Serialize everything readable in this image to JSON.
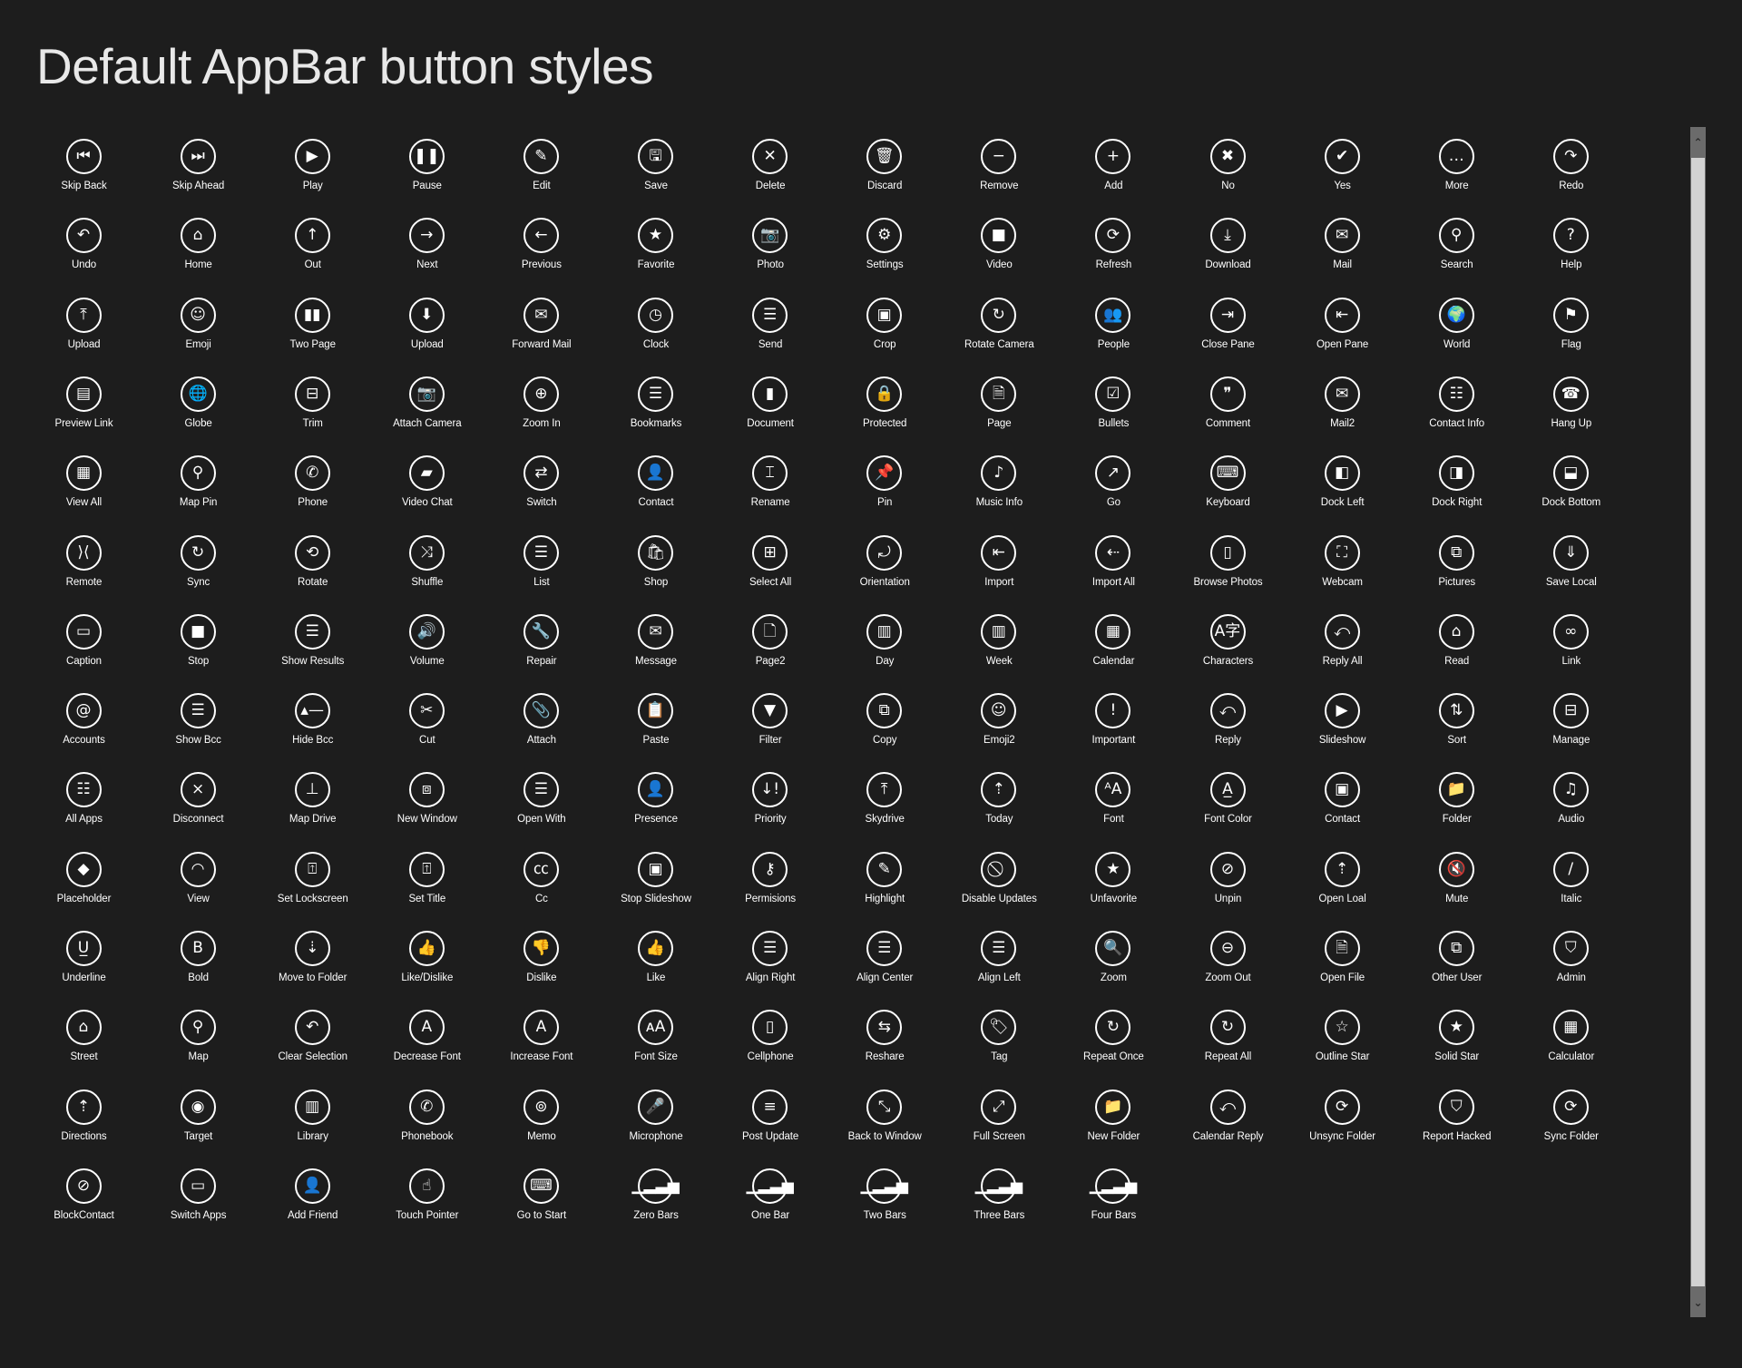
{
  "page": {
    "title": "Default AppBar button styles"
  },
  "colors": {
    "background": "#1d1d1d",
    "foreground": "#ffffff",
    "scrollbar_track": "#6b6b6b",
    "scrollbar_thumb": "#d2d2d2"
  },
  "scrollbar": {
    "up_glyph": "⌃",
    "down_glyph": "⌄"
  },
  "buttons": [
    {
      "label": "Skip Back",
      "icon": "skip-back-icon",
      "glyph": "⏮"
    },
    {
      "label": "Skip Ahead",
      "icon": "skip-ahead-icon",
      "glyph": "⏭"
    },
    {
      "label": "Play",
      "icon": "play-icon",
      "glyph": "▶"
    },
    {
      "label": "Pause",
      "icon": "pause-icon",
      "glyph": "❚❚"
    },
    {
      "label": "Edit",
      "icon": "pencil-icon",
      "glyph": "✎"
    },
    {
      "label": "Save",
      "icon": "floppy-icon",
      "glyph": "🖫"
    },
    {
      "label": "Delete",
      "icon": "delete-x-icon",
      "glyph": "✕"
    },
    {
      "label": "Discard",
      "icon": "trash-icon",
      "glyph": "🗑"
    },
    {
      "label": "Remove",
      "icon": "minus-icon",
      "glyph": "−"
    },
    {
      "label": "Add",
      "icon": "plus-icon",
      "glyph": "+"
    },
    {
      "label": "No",
      "icon": "x-icon",
      "glyph": "✖"
    },
    {
      "label": "Yes",
      "icon": "check-icon",
      "glyph": "✔"
    },
    {
      "label": "More",
      "icon": "ellipsis-icon",
      "glyph": "…"
    },
    {
      "label": "Redo",
      "icon": "redo-icon",
      "glyph": "↷"
    },
    {
      "label": "Undo",
      "icon": "undo-icon",
      "glyph": "↶"
    },
    {
      "label": "Home",
      "icon": "home-icon",
      "glyph": "⌂"
    },
    {
      "label": "Out",
      "icon": "arrow-up-icon",
      "glyph": "↑"
    },
    {
      "label": "Next",
      "icon": "arrow-right-icon",
      "glyph": "→"
    },
    {
      "label": "Previous",
      "icon": "arrow-left-icon",
      "glyph": "←"
    },
    {
      "label": "Favorite",
      "icon": "star-icon",
      "glyph": "★"
    },
    {
      "label": "Photo",
      "icon": "camera-icon",
      "glyph": "📷"
    },
    {
      "label": "Settings",
      "icon": "gear-icon",
      "glyph": "⚙"
    },
    {
      "label": "Video",
      "icon": "video-camera-icon",
      "glyph": "■"
    },
    {
      "label": "Refresh",
      "icon": "refresh-icon",
      "glyph": "⟳"
    },
    {
      "label": "Download",
      "icon": "download-icon",
      "glyph": "⤓"
    },
    {
      "label": "Mail",
      "icon": "mail-icon",
      "glyph": "✉"
    },
    {
      "label": "Search",
      "icon": "search-icon",
      "glyph": "⚲"
    },
    {
      "label": "Help",
      "icon": "question-icon",
      "glyph": "?"
    },
    {
      "label": "Upload",
      "icon": "upload-icon",
      "glyph": "⤒"
    },
    {
      "label": "Emoji",
      "icon": "emoji-icon",
      "glyph": "☺"
    },
    {
      "label": "Two Page",
      "icon": "two-page-icon",
      "glyph": "▮▮"
    },
    {
      "label": "Upload",
      "icon": "upload-bubble-icon",
      "glyph": "⬇"
    },
    {
      "label": "Forward Mail",
      "icon": "forward-mail-icon",
      "glyph": "✉"
    },
    {
      "label": "Clock",
      "icon": "clock-icon",
      "glyph": "◷"
    },
    {
      "label": "Send",
      "icon": "send-icon",
      "glyph": "☰"
    },
    {
      "label": "Crop",
      "icon": "crop-icon",
      "glyph": "▣"
    },
    {
      "label": "Rotate Camera",
      "icon": "rotate-camera-icon",
      "glyph": "↻"
    },
    {
      "label": "People",
      "icon": "people-icon",
      "glyph": "👥"
    },
    {
      "label": "Close Pane",
      "icon": "close-pane-icon",
      "glyph": "⇥"
    },
    {
      "label": "Open Pane",
      "icon": "open-pane-icon",
      "glyph": "⇤"
    },
    {
      "label": "World",
      "icon": "world-icon",
      "glyph": "🌍"
    },
    {
      "label": "Flag",
      "icon": "flag-icon",
      "glyph": "⚑"
    },
    {
      "label": "Preview Link",
      "icon": "preview-link-icon",
      "glyph": "▤"
    },
    {
      "label": "Globe",
      "icon": "globe-icon",
      "glyph": "🌐"
    },
    {
      "label": "Trim",
      "icon": "trim-icon",
      "glyph": "⊟"
    },
    {
      "label": "Attach Camera",
      "icon": "attach-camera-icon",
      "glyph": "📷"
    },
    {
      "label": "Zoom In",
      "icon": "zoom-in-icon",
      "glyph": "⊕"
    },
    {
      "label": "Bookmarks",
      "icon": "bookmarks-icon",
      "glyph": "☰"
    },
    {
      "label": "Document",
      "icon": "document-icon",
      "glyph": "▮"
    },
    {
      "label": "Protected",
      "icon": "protected-icon",
      "glyph": "🔒"
    },
    {
      "label": "Page",
      "icon": "page-icon",
      "glyph": "🗎"
    },
    {
      "label": "Bullets",
      "icon": "bullets-icon",
      "glyph": "☑"
    },
    {
      "label": "Comment",
      "icon": "comment-icon",
      "glyph": "❞"
    },
    {
      "label": "Mail2",
      "icon": "mail2-icon",
      "glyph": "✉"
    },
    {
      "label": "Contact Info",
      "icon": "contact-info-icon",
      "glyph": "☷"
    },
    {
      "label": "Hang Up",
      "icon": "hang-up-icon",
      "glyph": "☎"
    },
    {
      "label": "View All",
      "icon": "view-all-icon",
      "glyph": "▦"
    },
    {
      "label": "Map Pin",
      "icon": "map-pin-icon",
      "glyph": "⚲"
    },
    {
      "label": "Phone",
      "icon": "phone-icon",
      "glyph": "✆"
    },
    {
      "label": "Video Chat",
      "icon": "video-chat-icon",
      "glyph": "▰"
    },
    {
      "label": "Switch",
      "icon": "switch-icon",
      "glyph": "⇄"
    },
    {
      "label": "Contact",
      "icon": "contact-icon",
      "glyph": "👤"
    },
    {
      "label": "Rename",
      "icon": "rename-icon",
      "glyph": "⌶"
    },
    {
      "label": "Pin",
      "icon": "pin-icon",
      "glyph": "📌"
    },
    {
      "label": "Music Info",
      "icon": "music-info-icon",
      "glyph": "♪"
    },
    {
      "label": "Go",
      "icon": "go-arrow-icon",
      "glyph": "↗"
    },
    {
      "label": "Keyboard",
      "icon": "keyboard-icon",
      "glyph": "⌨"
    },
    {
      "label": "Dock Left",
      "icon": "dock-left-icon",
      "glyph": "◧"
    },
    {
      "label": "Dock Right",
      "icon": "dock-right-icon",
      "glyph": "◨"
    },
    {
      "label": "Dock Bottom",
      "icon": "dock-bottom-icon",
      "glyph": "⬓"
    },
    {
      "label": "Remote",
      "icon": "remote-icon",
      "glyph": "⟩⟨"
    },
    {
      "label": "Sync",
      "icon": "sync-icon",
      "glyph": "↻"
    },
    {
      "label": "Rotate",
      "icon": "rotate-icon",
      "glyph": "⟲"
    },
    {
      "label": "Shuffle",
      "icon": "shuffle-icon",
      "glyph": "⤨"
    },
    {
      "label": "List",
      "icon": "list-icon",
      "glyph": "☰"
    },
    {
      "label": "Shop",
      "icon": "shop-bag-icon",
      "glyph": "🛍"
    },
    {
      "label": "Select All",
      "icon": "select-all-icon",
      "glyph": "⊞"
    },
    {
      "label": "Orientation",
      "icon": "orientation-icon",
      "glyph": "⤾"
    },
    {
      "label": "Import",
      "icon": "import-icon",
      "glyph": "⇤"
    },
    {
      "label": "Import All",
      "icon": "import-all-icon",
      "glyph": "⇠"
    },
    {
      "label": "Browse Photos",
      "icon": "browse-photos-icon",
      "glyph": "▯"
    },
    {
      "label": "Webcam",
      "icon": "webcam-icon",
      "glyph": "⛶"
    },
    {
      "label": "Pictures",
      "icon": "pictures-icon",
      "glyph": "⧉"
    },
    {
      "label": "Save Local",
      "icon": "save-local-icon",
      "glyph": "⇓"
    },
    {
      "label": "Caption",
      "icon": "caption-icon",
      "glyph": "▭"
    },
    {
      "label": "Stop",
      "icon": "stop-icon",
      "glyph": "■"
    },
    {
      "label": "Show Results",
      "icon": "show-results-icon",
      "glyph": "☰"
    },
    {
      "label": "Volume",
      "icon": "volume-icon",
      "glyph": "🔊"
    },
    {
      "label": "Repair",
      "icon": "wrench-icon",
      "glyph": "🔧"
    },
    {
      "label": "Message",
      "icon": "message-icon",
      "glyph": "✉"
    },
    {
      "label": "Page2",
      "icon": "page2-icon",
      "glyph": "🗋"
    },
    {
      "label": "Day",
      "icon": "day-calendar-icon",
      "glyph": "▥"
    },
    {
      "label": "Week",
      "icon": "week-calendar-icon",
      "glyph": "▥"
    },
    {
      "label": "Calendar",
      "icon": "calendar-icon",
      "glyph": "▦"
    },
    {
      "label": "Characters",
      "icon": "characters-icon",
      "glyph": "A字"
    },
    {
      "label": "Reply All",
      "icon": "reply-all-icon",
      "glyph": "⤺"
    },
    {
      "label": "Read",
      "icon": "read-envelope-icon",
      "glyph": "⌂"
    },
    {
      "label": "Link",
      "icon": "link-icon",
      "glyph": "∞"
    },
    {
      "label": "Accounts",
      "icon": "at-sign-icon",
      "glyph": "@"
    },
    {
      "label": "Show Bcc",
      "icon": "show-bcc-icon",
      "glyph": "☰"
    },
    {
      "label": "Hide Bcc",
      "icon": "hide-bcc-icon",
      "glyph": "▴—"
    },
    {
      "label": "Cut",
      "icon": "scissors-icon",
      "glyph": "✂"
    },
    {
      "label": "Attach",
      "icon": "paperclip-icon",
      "glyph": "📎"
    },
    {
      "label": "Paste",
      "icon": "paste-icon",
      "glyph": "📋"
    },
    {
      "label": "Filter",
      "icon": "filter-icon",
      "glyph": "▼"
    },
    {
      "label": "Copy",
      "icon": "copy-icon",
      "glyph": "⧉"
    },
    {
      "label": "Emoji2",
      "icon": "emoji2-icon",
      "glyph": "☺"
    },
    {
      "label": "Important",
      "icon": "important-icon",
      "glyph": "!"
    },
    {
      "label": "Reply",
      "icon": "reply-icon",
      "glyph": "⤺"
    },
    {
      "label": "Slideshow",
      "icon": "slideshow-icon",
      "glyph": "▶"
    },
    {
      "label": "Sort",
      "icon": "sort-icon",
      "glyph": "⇅"
    },
    {
      "label": "Manage",
      "icon": "manage-icon",
      "glyph": "⊟"
    },
    {
      "label": "All Apps",
      "icon": "all-apps-icon",
      "glyph": "☷"
    },
    {
      "label": "Disconnect",
      "icon": "disconnect-icon",
      "glyph": "⨯"
    },
    {
      "label": "Map Drive",
      "icon": "map-drive-icon",
      "glyph": "⊥"
    },
    {
      "label": "New Window",
      "icon": "new-window-icon",
      "glyph": "⧈"
    },
    {
      "label": "Open With",
      "icon": "open-with-icon",
      "glyph": "☰"
    },
    {
      "label": "Presence",
      "icon": "presence-icon",
      "glyph": "👤"
    },
    {
      "label": "Priority",
      "icon": "priority-icon",
      "glyph": "↓!"
    },
    {
      "label": "Skydrive",
      "icon": "skydrive-icon",
      "glyph": "⤒"
    },
    {
      "label": "Today",
      "icon": "today-icon",
      "glyph": "⇡"
    },
    {
      "label": "Font",
      "icon": "font-icon",
      "glyph": "ᴬA"
    },
    {
      "label": "Font Color",
      "icon": "font-color-icon",
      "glyph": "A̲"
    },
    {
      "label": "Contact",
      "icon": "contact-card-icon",
      "glyph": "▣"
    },
    {
      "label": "Folder",
      "icon": "folder-icon",
      "glyph": "📁"
    },
    {
      "label": "Audio",
      "icon": "audio-note-icon",
      "glyph": "♫"
    },
    {
      "label": "Placeholder",
      "icon": "placeholder-diamond-icon",
      "glyph": "◆"
    },
    {
      "label": "View",
      "icon": "view-eye-icon",
      "glyph": "◠"
    },
    {
      "label": "Set Lockscreen",
      "icon": "set-lockscreen-icon",
      "glyph": "⍐"
    },
    {
      "label": "Set Title",
      "icon": "set-title-icon",
      "glyph": "⍐"
    },
    {
      "label": "Cc",
      "icon": "cc-icon",
      "glyph": "㏄"
    },
    {
      "label": "Stop Slideshow",
      "icon": "stop-slideshow-icon",
      "glyph": "▣"
    },
    {
      "label": "Permisions",
      "icon": "key-icon",
      "glyph": "⚷"
    },
    {
      "label": "Highlight",
      "icon": "highlight-icon",
      "glyph": "✎"
    },
    {
      "label": "Disable Updates",
      "icon": "disable-updates-icon",
      "glyph": "⃠"
    },
    {
      "label": "Unfavorite",
      "icon": "unfavorite-icon",
      "glyph": "★"
    },
    {
      "label": "Unpin",
      "icon": "unpin-icon",
      "glyph": "⊘"
    },
    {
      "label": "Open Loal",
      "icon": "open-local-icon",
      "glyph": "⇡"
    },
    {
      "label": "Mute",
      "icon": "mute-icon",
      "glyph": "🔇"
    },
    {
      "label": "Italic",
      "icon": "italic-icon",
      "glyph": "/"
    },
    {
      "label": "Underline",
      "icon": "underline-icon",
      "glyph": "U̲"
    },
    {
      "label": "Bold",
      "icon": "bold-icon",
      "glyph": "B"
    },
    {
      "label": "Move to Folder",
      "icon": "move-to-folder-icon",
      "glyph": "⇣"
    },
    {
      "label": "Like/Dislike",
      "icon": "like-dislike-icon",
      "glyph": "👍"
    },
    {
      "label": "Dislike",
      "icon": "thumbs-down-icon",
      "glyph": "👎"
    },
    {
      "label": "Like",
      "icon": "thumbs-up-icon",
      "glyph": "👍"
    },
    {
      "label": "Align Right",
      "icon": "align-right-icon",
      "glyph": "☰"
    },
    {
      "label": "Align Center",
      "icon": "align-center-icon",
      "glyph": "☰"
    },
    {
      "label": "Align Left",
      "icon": "align-left-icon",
      "glyph": "☰"
    },
    {
      "label": "Zoom",
      "icon": "zoom-icon",
      "glyph": "🔍"
    },
    {
      "label": "Zoom Out",
      "icon": "zoom-out-icon",
      "glyph": "⊖"
    },
    {
      "label": "Open File",
      "icon": "open-file-icon",
      "glyph": "🗎"
    },
    {
      "label": "Other User",
      "icon": "other-user-icon",
      "glyph": "⧉"
    },
    {
      "label": "Admin",
      "icon": "admin-shield-icon",
      "glyph": "⛉"
    },
    {
      "label": "Street",
      "icon": "street-icon",
      "glyph": "⌂"
    },
    {
      "label": "Map",
      "icon": "map-icon",
      "glyph": "⚲"
    },
    {
      "label": "Clear Selection",
      "icon": "clear-selection-icon",
      "glyph": "↶"
    },
    {
      "label": "Decrease Font",
      "icon": "decrease-font-icon",
      "glyph": "A"
    },
    {
      "label": "Increase Font",
      "icon": "increase-font-icon",
      "glyph": "A"
    },
    {
      "label": "Font Size",
      "icon": "font-size-icon",
      "glyph": "ᴀA"
    },
    {
      "label": "Cellphone",
      "icon": "cellphone-icon",
      "glyph": "▯"
    },
    {
      "label": "Reshare",
      "icon": "reshare-icon",
      "glyph": "⇆"
    },
    {
      "label": "Tag",
      "icon": "tag-icon",
      "glyph": "🏷"
    },
    {
      "label": "Repeat Once",
      "icon": "repeat-once-icon",
      "glyph": "↻"
    },
    {
      "label": "Repeat All",
      "icon": "repeat-all-icon",
      "glyph": "↻"
    },
    {
      "label": "Outline Star",
      "icon": "outline-star-icon",
      "glyph": "☆"
    },
    {
      "label": "Solid Star",
      "icon": "solid-star-icon",
      "glyph": "★"
    },
    {
      "label": "Calculator",
      "icon": "calculator-icon",
      "glyph": "▦"
    },
    {
      "label": "Directions",
      "icon": "directions-icon",
      "glyph": "⇡"
    },
    {
      "label": "Target",
      "icon": "target-icon",
      "glyph": "◉"
    },
    {
      "label": "Library",
      "icon": "library-icon",
      "glyph": "▥"
    },
    {
      "label": "Phonebook",
      "icon": "phonebook-icon",
      "glyph": "✆"
    },
    {
      "label": "Memo",
      "icon": "memo-icon",
      "glyph": "⊚"
    },
    {
      "label": "Microphone",
      "icon": "microphone-icon",
      "glyph": "🎤"
    },
    {
      "label": "Post Update",
      "icon": "post-update-icon",
      "glyph": "≡"
    },
    {
      "label": "Back to Window",
      "icon": "back-to-window-icon",
      "glyph": "⤡"
    },
    {
      "label": "Full Screen",
      "icon": "full-screen-icon",
      "glyph": "⤢"
    },
    {
      "label": "New Folder",
      "icon": "new-folder-icon",
      "glyph": "📁"
    },
    {
      "label": "Calendar Reply",
      "icon": "calendar-reply-icon",
      "glyph": "⤺"
    },
    {
      "label": "Unsync Folder",
      "icon": "unsync-folder-icon",
      "glyph": "⟳"
    },
    {
      "label": "Report Hacked",
      "icon": "report-hacked-icon",
      "glyph": "⛉"
    },
    {
      "label": "Sync Folder",
      "icon": "sync-folder-icon",
      "glyph": "⟳"
    },
    {
      "label": "BlockContact",
      "icon": "block-contact-icon",
      "glyph": "⊘"
    },
    {
      "label": "Switch Apps",
      "icon": "switch-apps-icon",
      "glyph": "▭"
    },
    {
      "label": "Add Friend",
      "icon": "add-friend-icon",
      "glyph": "👤"
    },
    {
      "label": "Touch Pointer",
      "icon": "touch-pointer-icon",
      "glyph": "☝"
    },
    {
      "label": "Go to Start",
      "icon": "go-to-start-icon",
      "glyph": "⌨"
    },
    {
      "label": "Zero Bars",
      "icon": "signal-zero-bars-icon",
      "glyph": "▁▂▃▅"
    },
    {
      "label": "One Bar",
      "icon": "signal-one-bar-icon",
      "glyph": "▁▂▃▅"
    },
    {
      "label": "Two Bars",
      "icon": "signal-two-bars-icon",
      "glyph": "▁▂▃▅"
    },
    {
      "label": "Three Bars",
      "icon": "signal-three-bars-icon",
      "glyph": "▁▂▃▅"
    },
    {
      "label": "Four Bars",
      "icon": "signal-four-bars-icon",
      "glyph": "▁▂▃▅"
    }
  ]
}
